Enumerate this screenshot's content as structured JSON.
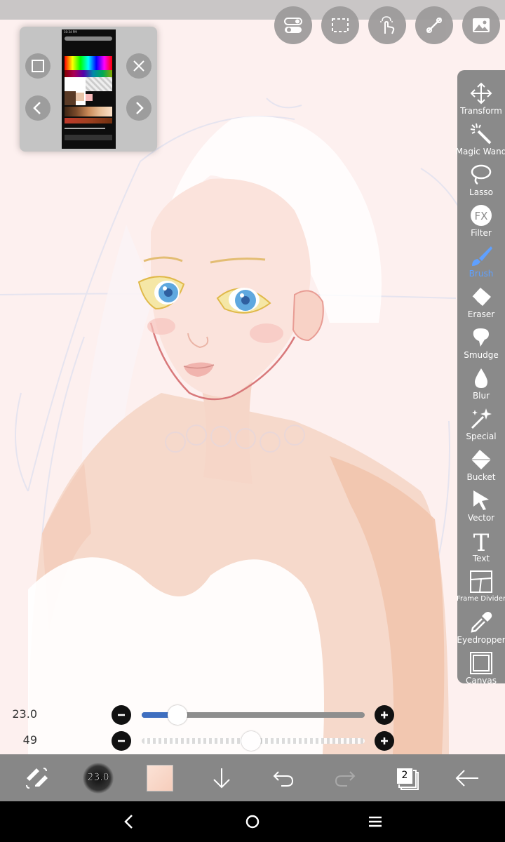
{
  "app": {
    "name": "ibisPaint X drawing canvas"
  },
  "colors": {
    "canvas_bg": "#fdf0ef",
    "panel_bg": "#8a8a8a",
    "active_tool": "#5fa0ff",
    "brush_slider_fill": "#3f6fc0"
  },
  "top_toolbar": {
    "buttons": [
      {
        "icon": "toggle-settings-icon"
      },
      {
        "icon": "selection-icon"
      },
      {
        "icon": "touch-gesture-icon"
      },
      {
        "icon": "ruler-icon"
      },
      {
        "icon": "image-gallery-icon"
      }
    ]
  },
  "reference_window": {
    "thumbnail": {
      "status_time": "10:34 PM",
      "size_label": "23.0"
    }
  },
  "tools": [
    {
      "label": "Transform",
      "icon": "move-arrows-icon"
    },
    {
      "label": "Magic Wand",
      "icon": "magic-wand-icon"
    },
    {
      "label": "Lasso",
      "icon": "lasso-icon"
    },
    {
      "label": "Filter",
      "icon": "fx-filter-icon",
      "glyph": "FX"
    },
    {
      "label": "Brush",
      "icon": "brush-icon",
      "active": true
    },
    {
      "label": "Eraser",
      "icon": "eraser-icon"
    },
    {
      "label": "Smudge",
      "icon": "smudge-icon"
    },
    {
      "label": "Blur",
      "icon": "blur-drop-icon"
    },
    {
      "label": "Special",
      "icon": "special-sparkle-icon"
    },
    {
      "label": "Bucket",
      "icon": "bucket-icon"
    },
    {
      "label": "Vector",
      "icon": "vector-cursor-icon"
    },
    {
      "label": "Text",
      "icon": "text-icon",
      "glyph": "T"
    },
    {
      "label": "Frame Divider",
      "icon": "frame-divider-icon"
    },
    {
      "label": "Eyedropper",
      "icon": "eyedropper-icon"
    },
    {
      "label": "Canvas",
      "icon": "canvas-icon"
    }
  ],
  "brush_size": {
    "value": "23.0",
    "fraction": 0.14
  },
  "brush_opacity": {
    "value": "49",
    "fraction": 0.49
  },
  "bottom_toolbar": {
    "brush_preview_label": "23.0",
    "layer_count": "2",
    "items": [
      {
        "icon": "swap-tool-icon"
      },
      {
        "icon": "brush-preview-icon"
      },
      {
        "icon": "color-swatch-icon"
      },
      {
        "icon": "download-arrow-icon"
      },
      {
        "icon": "undo-icon"
      },
      {
        "icon": "redo-icon"
      },
      {
        "icon": "layers-icon"
      },
      {
        "icon": "back-arrow-icon"
      }
    ]
  },
  "nav_bar": [
    {
      "icon": "nav-back-icon"
    },
    {
      "icon": "nav-home-icon"
    },
    {
      "icon": "nav-menu-icon"
    }
  ]
}
